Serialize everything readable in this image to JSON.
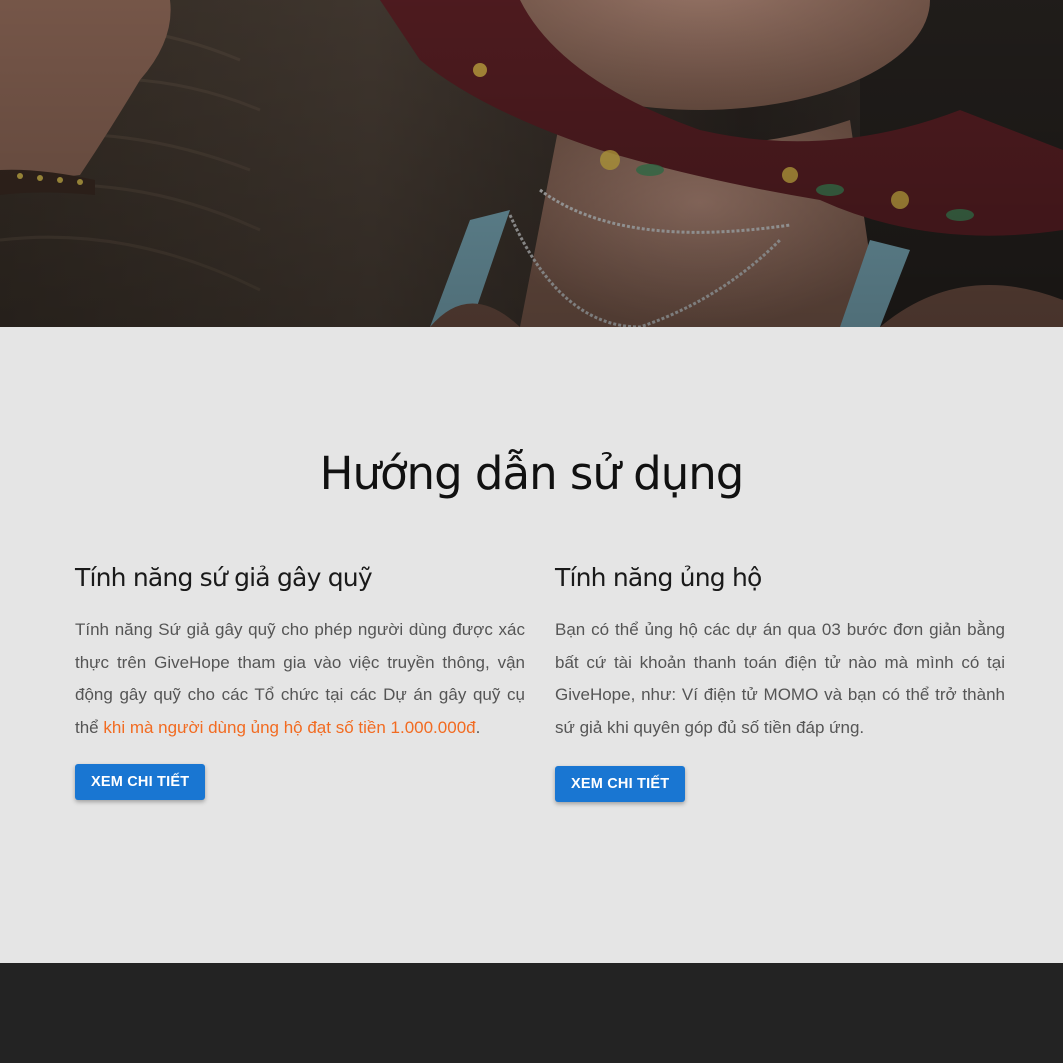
{
  "guide": {
    "title": "Hướng dẫn sử dụng",
    "features": [
      {
        "title": "Tính năng sứ giả gây quỹ",
        "text_before": "Tính năng Sứ giả gây quỹ cho phép người dùng được xác thực trên GiveHope tham gia vào việc truyền thông, vận động gây quỹ cho các Tổ chức tại các Dự án gây quỹ cụ thể ",
        "highlight": "khi mà người dùng ủng hộ đạt số tiền 1.000.000đ",
        "text_after": ".",
        "button_label": "XEM CHI TIẾT"
      },
      {
        "title": "Tính năng ủng hộ",
        "text": "Bạn có thể ủng hộ các dự án qua 03 bước đơn giản bằng bất cứ tài khoản thanh toán điện tử nào mà mình có tại GiveHope, như: Ví điện tử MOMO và bạn có thể trở thành sứ giả khi quyên góp đủ số tiền đáp ứng.",
        "button_label": "XEM CHI TIẾT"
      }
    ]
  },
  "colors": {
    "accent": "#1976d2",
    "highlight": "#f26b21",
    "section_bg": "#e5e5e5",
    "footer_bg": "#232323"
  }
}
